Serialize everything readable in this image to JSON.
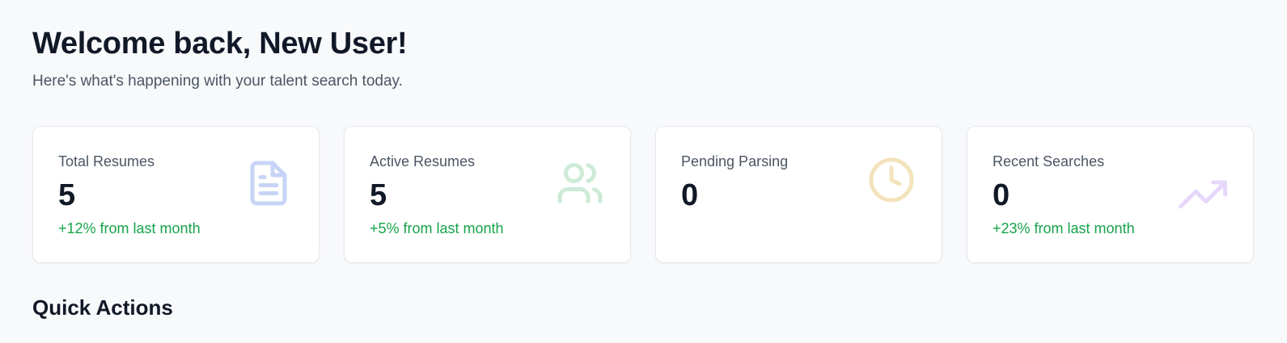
{
  "header": {
    "title": "Welcome back, New User!",
    "subtitle": "Here's what's happening with your talent search today."
  },
  "stats": [
    {
      "label": "Total Resumes",
      "value": "5",
      "change": "+12% from last month",
      "icon": "document-icon",
      "icon_color": "#c7d4f7"
    },
    {
      "label": "Active Resumes",
      "value": "5",
      "change": "+5% from last month",
      "icon": "users-icon",
      "icon_color": "#cdebd6"
    },
    {
      "label": "Pending Parsing",
      "value": "0",
      "change": "",
      "icon": "clock-icon",
      "icon_color": "#f3e3bd"
    },
    {
      "label": "Recent Searches",
      "value": "0",
      "change": "+23% from last month",
      "icon": "trending-up-icon",
      "icon_color": "#e6d7fb"
    }
  ],
  "quick_actions": {
    "title": "Quick Actions"
  },
  "colors": {
    "background": "#f8f9fb",
    "positive": "#16a34a",
    "text_primary": "#111827",
    "text_secondary": "#4b5563"
  }
}
